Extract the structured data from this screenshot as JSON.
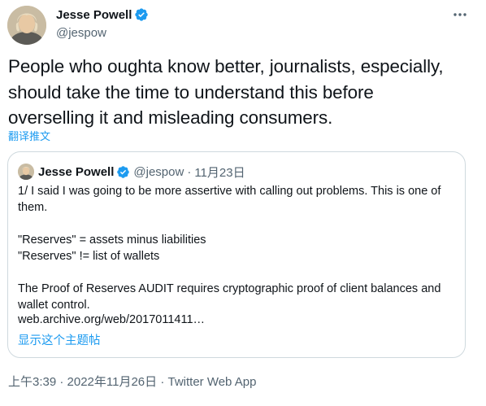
{
  "tweet": {
    "author": {
      "name": "Jesse Powell",
      "handle": "@jespow"
    },
    "text": "People who oughta know better, journalists, especially,\nshould take the time to understand this before\noverselling it and misleading consumers.",
    "translate_label": "翻译推文",
    "quoted": {
      "author": {
        "name": "Jesse Powell",
        "handle": "@jespow"
      },
      "separator": "·",
      "date": "11月23日",
      "body": "1/ I said I was going to be more assertive with calling out problems. This is one of\nthem.\n\n\"Reserves\" = assets minus liabilities\n\"Reserves\" != list of wallets\n\nThe Proof of Reserves AUDIT requires cryptographic proof of client balances and\nwallet control.",
      "link": "web.archive.org/web/2017011411…",
      "thread_label": "显示这个主题帖"
    },
    "timestamp": "上午3:39 · 2022年11月26日 · Twitter Web App"
  },
  "colors": {
    "verified": "#1d9bf0",
    "link": "#1d9bf0",
    "secondary_text": "#536471",
    "border": "#cfd9de"
  },
  "icons": {
    "verified": "verified-badge-icon",
    "more": "more-horizontal-icon"
  }
}
